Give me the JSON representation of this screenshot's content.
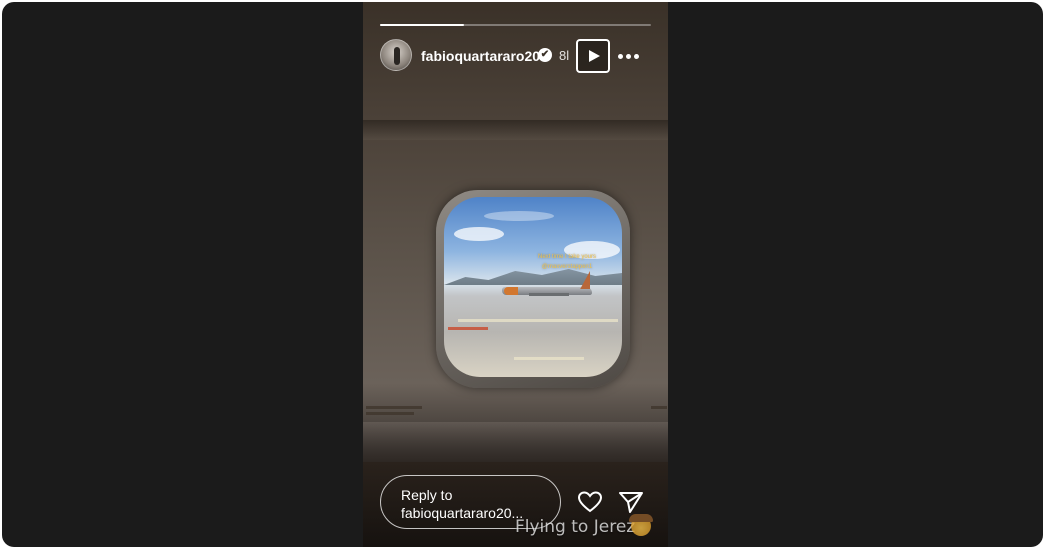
{
  "story": {
    "username": "fabioquartararo20",
    "verified_mark": "✔",
    "time_ago": "8l",
    "progress_fraction": 0.31,
    "overlay_caption": "Next time I take yours @maxverstappen1",
    "reply": {
      "line1": "Reply to",
      "line2": "fabioquartararo20..."
    },
    "watermark": "Flying to Jerez",
    "icons": {
      "play": "play-icon",
      "more": "more-options-icon",
      "heart": "heart-icon",
      "send": "send-icon",
      "verified": "verified-badge-icon",
      "emoji": "cowboy-emoji-icon"
    }
  },
  "colors": {
    "backdrop": "#1b1b1b",
    "text": "#ffffff",
    "caption_accent": "#f0c24a"
  }
}
